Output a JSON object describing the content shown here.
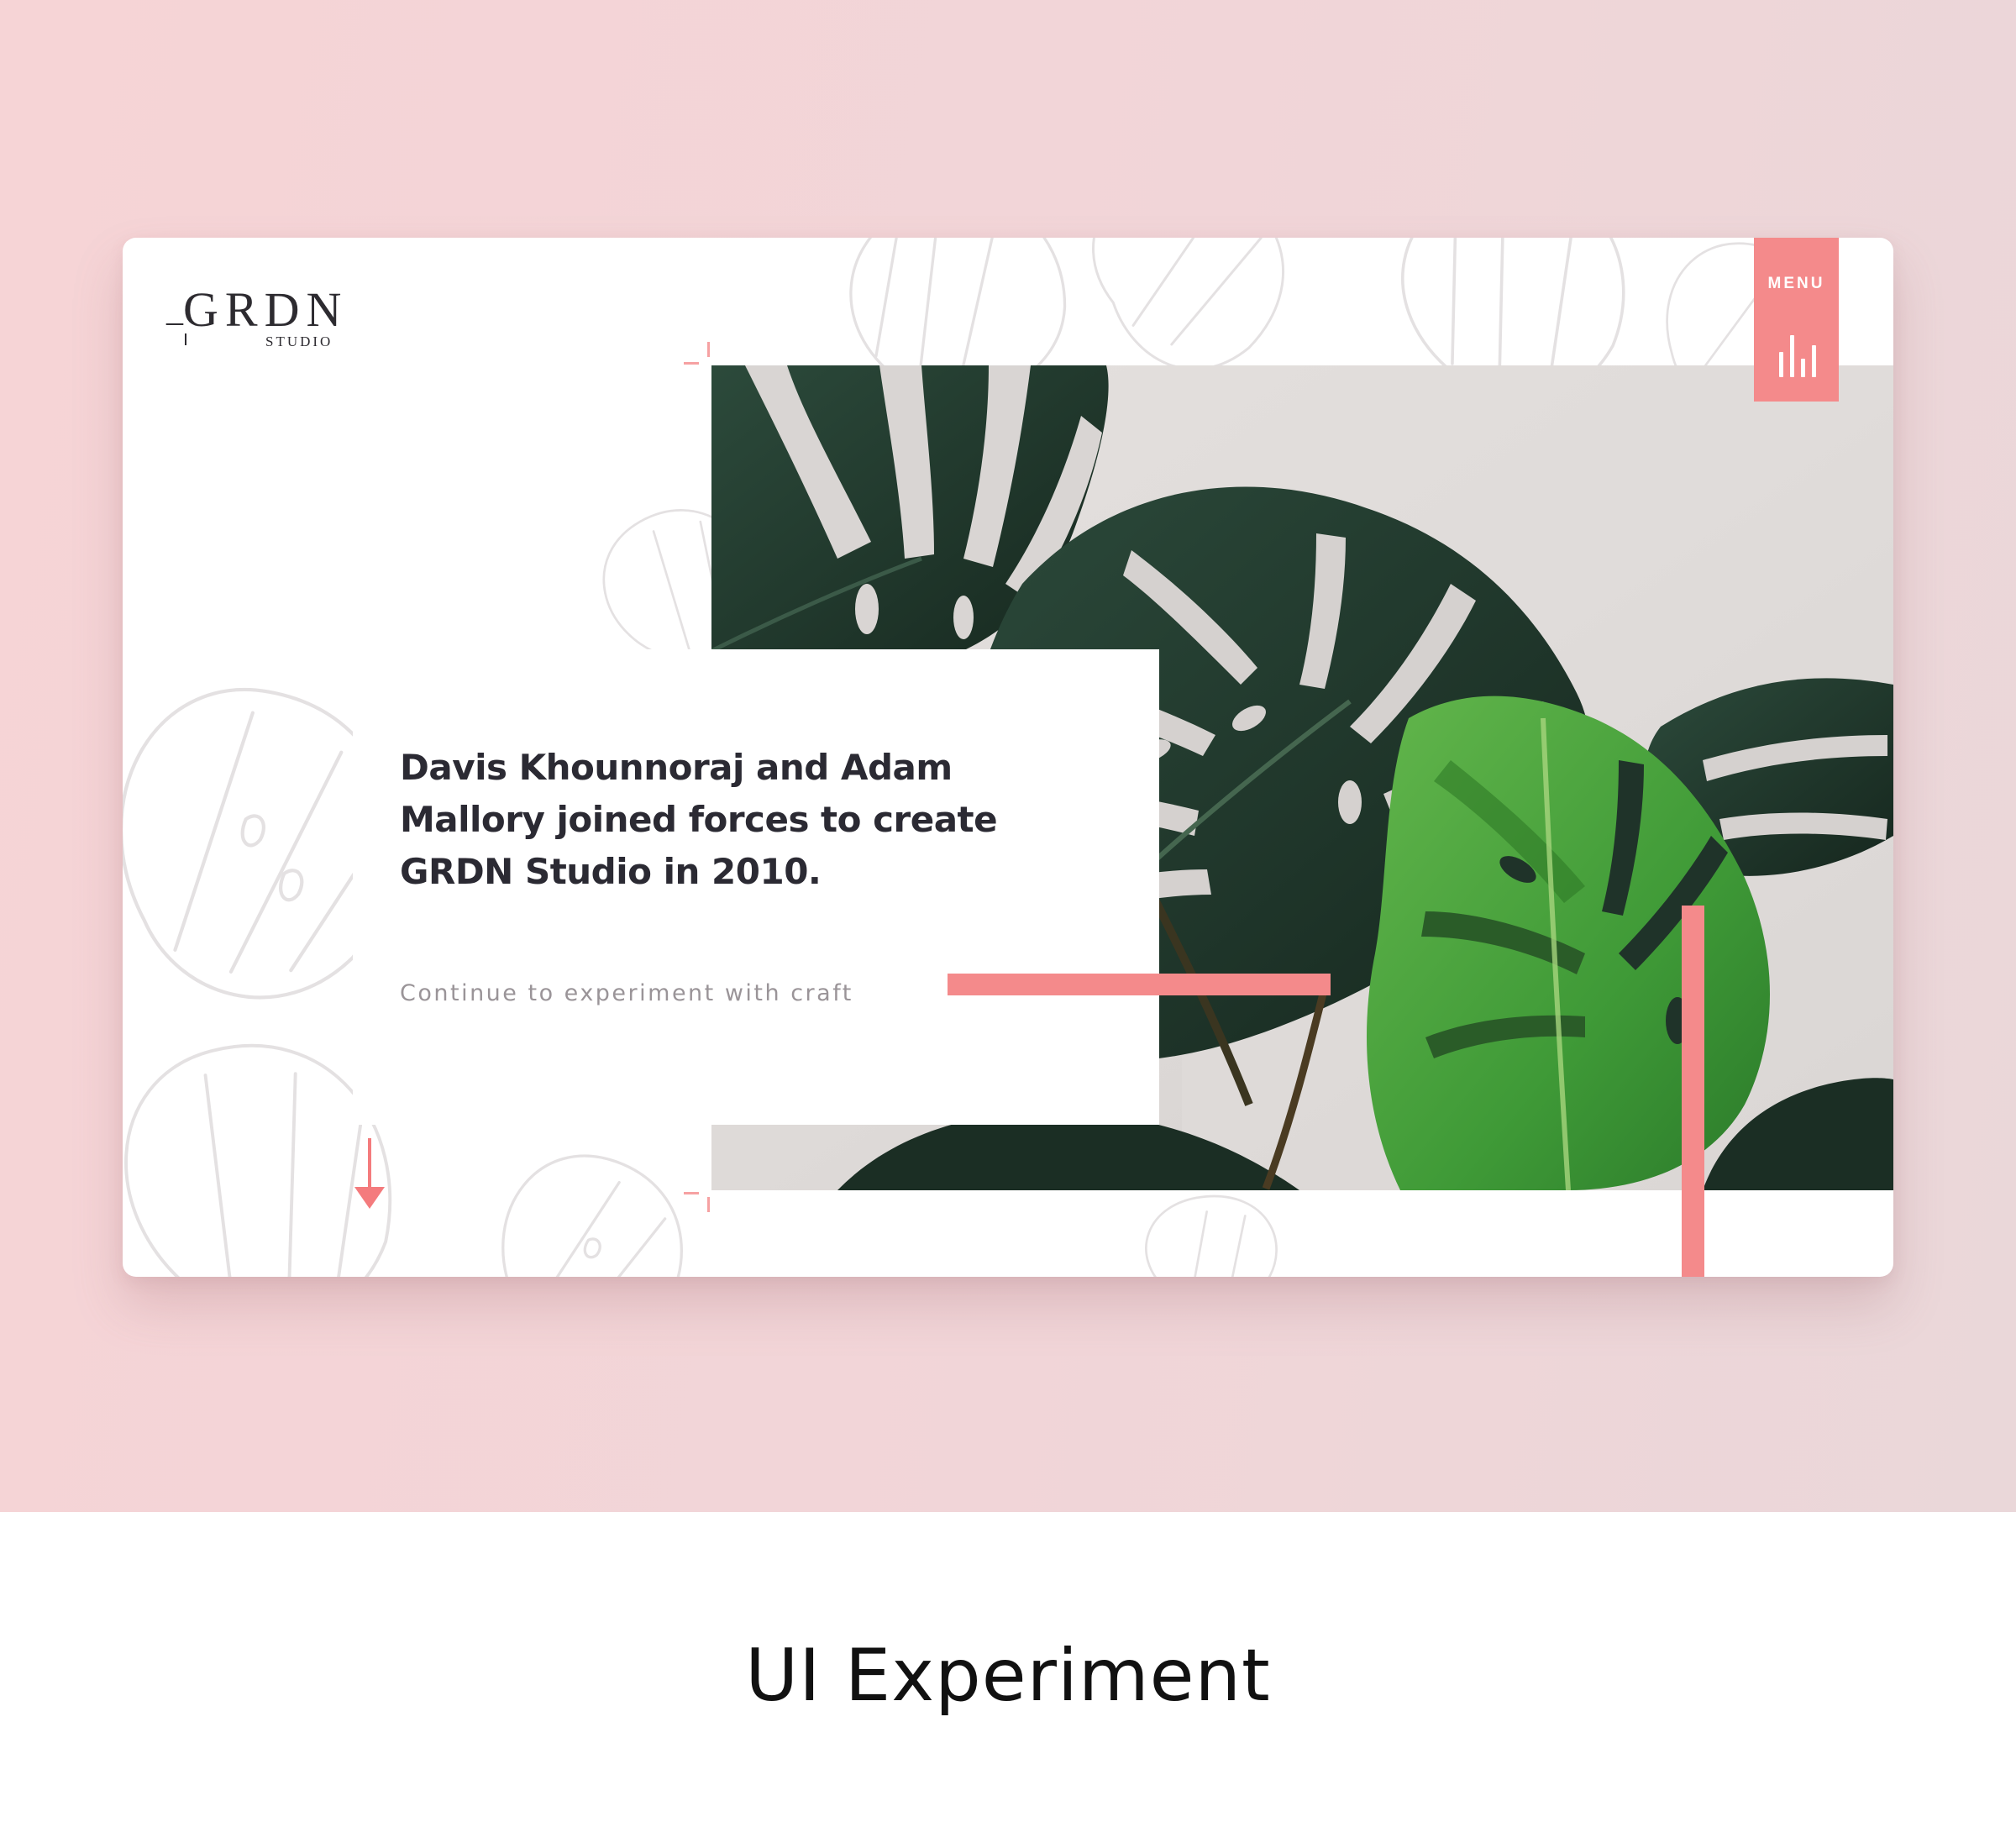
{
  "brand": {
    "logo_text": "GRDN",
    "logo_prefix": "_",
    "logo_subtext": "STUDIO"
  },
  "nav": {
    "menu_label": "MENU",
    "menu_icon": "bars-icon"
  },
  "hero": {
    "headline": "Davis Khounnoraj and Adam Mallory joined forces to create GRDN Studio in 2010.",
    "subline": "Continue to experiment with craft",
    "scroll_icon": "arrow-down-icon"
  },
  "caption": "UI Experiment",
  "colors": {
    "accent": "#f48a8b",
    "background_pink": "#f3d5d7",
    "text_dark": "#2b2a33",
    "leaf_dark": "#1f3329",
    "leaf_bright": "#3f9a37"
  }
}
